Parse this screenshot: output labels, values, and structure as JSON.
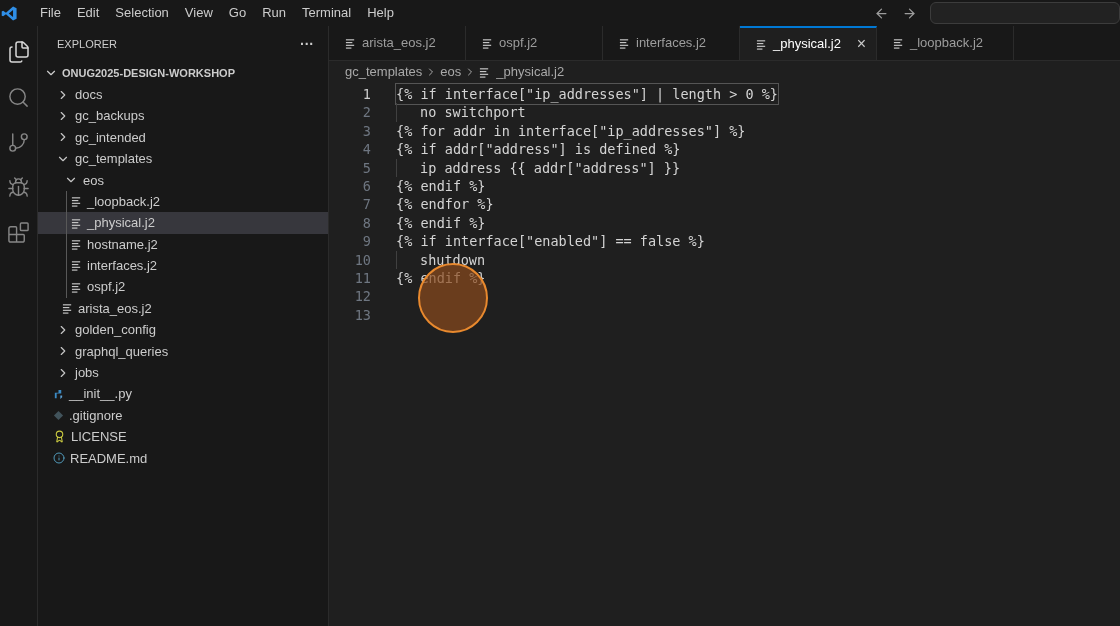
{
  "menu": [
    "File",
    "Edit",
    "Selection",
    "View",
    "Go",
    "Run",
    "Terminal",
    "Help"
  ],
  "explorer": {
    "title": "EXPLORER",
    "more": "···",
    "root": {
      "label": "ONUG2025-DESIGN-WORKSHOP",
      "expanded": true
    },
    "items": [
      {
        "label": "docs",
        "kind": "folder",
        "expanded": false,
        "selected": false
      },
      {
        "label": "gc_backups",
        "kind": "folder",
        "expanded": false,
        "selected": false
      },
      {
        "label": "gc_intended",
        "kind": "folder",
        "expanded": false,
        "selected": false
      },
      {
        "label": "gc_templates",
        "kind": "folder",
        "expanded": true,
        "selected": false,
        "children": [
          {
            "label": "eos",
            "kind": "folder",
            "expanded": true,
            "selected": false,
            "children": [
              {
                "label": "_loopback.j2",
                "kind": "template",
                "selected": false
              },
              {
                "label": "_physical.j2",
                "kind": "template",
                "selected": true
              },
              {
                "label": "hostname.j2",
                "kind": "template",
                "selected": false
              },
              {
                "label": "interfaces.j2",
                "kind": "template",
                "selected": false
              },
              {
                "label": "ospf.j2",
                "kind": "template",
                "selected": false
              }
            ]
          },
          {
            "label": "arista_eos.j2",
            "kind": "template",
            "selected": false
          }
        ]
      },
      {
        "label": "golden_config",
        "kind": "folder",
        "expanded": false,
        "selected": false
      },
      {
        "label": "graphql_queries",
        "kind": "folder",
        "expanded": false,
        "selected": false
      },
      {
        "label": "jobs",
        "kind": "folder",
        "expanded": false,
        "selected": false
      },
      {
        "label": "__init__.py",
        "kind": "python",
        "selected": false
      },
      {
        "label": ".gitignore",
        "kind": "git",
        "selected": false
      },
      {
        "label": "LICENSE",
        "kind": "license",
        "selected": false
      },
      {
        "label": "README.md",
        "kind": "info",
        "selected": false
      }
    ]
  },
  "tabs": [
    {
      "label": "arista_eos.j2",
      "selected": false
    },
    {
      "label": "ospf.j2",
      "selected": false
    },
    {
      "label": "interfaces.j2",
      "selected": false
    },
    {
      "label": "_physical.j2",
      "selected": true,
      "close": "×"
    },
    {
      "label": "_loopback.j2",
      "selected": false
    }
  ],
  "breadcrumb": [
    "gc_templates",
    "eos",
    "_physical.j2"
  ],
  "code_lines": [
    {
      "number": "1",
      "text": "{% if interface[\"ip_addresses\"] | length > 0 %}",
      "indented": false,
      "current": true
    },
    {
      "number": "2",
      "text": "no switchport",
      "indented": true,
      "current": false
    },
    {
      "number": "3",
      "text": "{% for addr in interface[\"ip_addresses\"] %}",
      "indented": false,
      "current": false
    },
    {
      "number": "4",
      "text": "{% if addr[\"address\"] is defined %}",
      "indented": false,
      "current": false
    },
    {
      "number": "5",
      "text": "ip address {{ addr[\"address\"] }}",
      "indented": true,
      "current": false
    },
    {
      "number": "6",
      "text": "{% endif %}",
      "indented": false,
      "current": false
    },
    {
      "number": "7",
      "text": "{% endfor %}",
      "indented": false,
      "current": false
    },
    {
      "number": "8",
      "text": "{% endif %}",
      "indented": false,
      "current": false
    },
    {
      "number": "9",
      "text": "{% if interface[\"enabled\"] == false %}",
      "indented": false,
      "current": false
    },
    {
      "number": "10",
      "text": "shutdown",
      "indented": true,
      "current": false
    },
    {
      "number": "11",
      "text": "{% endif %}",
      "indented": false,
      "current": false
    },
    {
      "number": "12",
      "indented": false,
      "current": false
    },
    {
      "number": "13",
      "indented": false,
      "current": false
    }
  ]
}
